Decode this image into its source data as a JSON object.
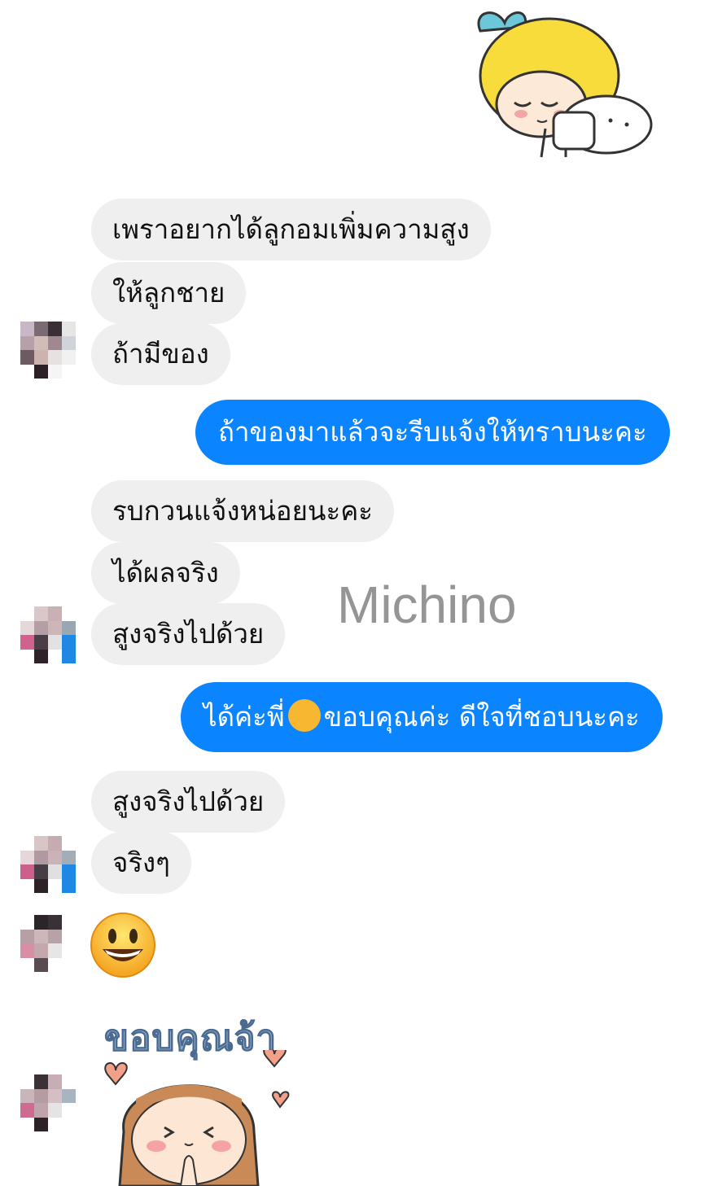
{
  "conversation": {
    "watermark": "Michino",
    "group1": {
      "msg1": "เพราอยากได้ลูกอมเพิ่มความสูง",
      "msg2": "ให้ลูกชาย",
      "msg3": "ถ้ามีของ"
    },
    "reply1": "ถ้าของมาแล้วจะรีบแจ้งให้ทราบนะคะ",
    "group2": {
      "msg1": "รบกวนแจ้งหน่อยนะคะ",
      "msg2": "ได้ผลจริง",
      "msg3": "สูงจริงไปด้วย"
    },
    "reply2": {
      "part1": "ได้ค่ะพี่",
      "part2": "ขอบคุณค่ะ ดีใจที่ชอบนะคะ"
    },
    "group3": {
      "msg1": "สูงจริงไปด้วย",
      "msg2": "จริงๆ"
    },
    "sticker_text": "ขอบคุณจ้า"
  },
  "colors": {
    "incoming_bubble": "#efeff0",
    "outgoing_bubble": "#0b84ff",
    "sticker_hair_yellow": "#f7dc3b",
    "sticker_bow": "#6cc8d8",
    "emoji_yellow": "#f7b731"
  },
  "icons": {
    "smile": "grinning-face-emoji",
    "blush": "smiling-face-with-hearts-emoji"
  }
}
